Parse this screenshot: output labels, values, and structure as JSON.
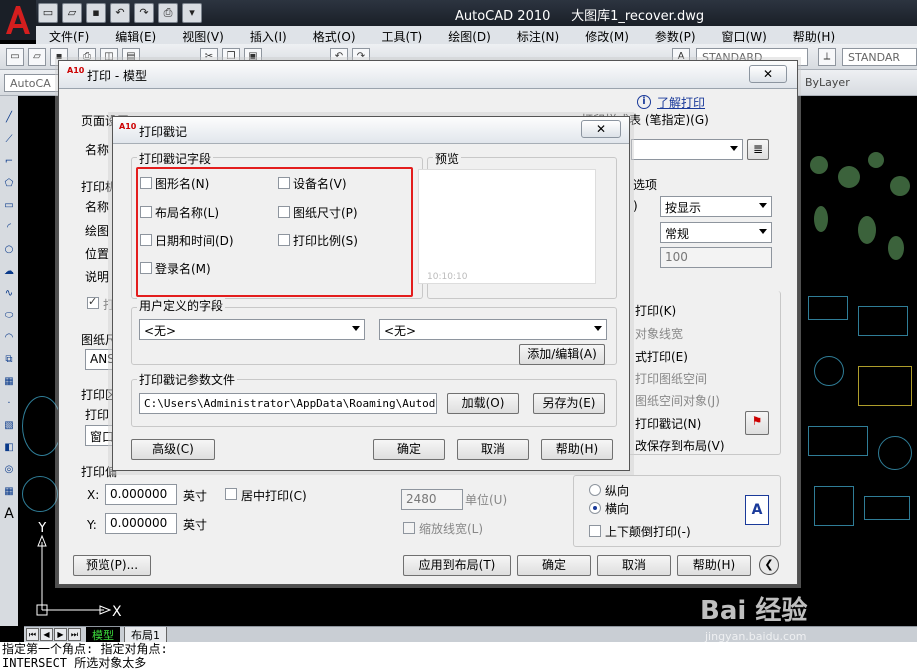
{
  "app": {
    "title": "AutoCAD 2010",
    "file": "大图库1_recover.dwg",
    "menus": [
      "文件(F)",
      "编辑(E)",
      "视图(V)",
      "插入(I)",
      "格式(O)",
      "工具(T)",
      "绘图(D)",
      "标注(N)",
      "修改(M)",
      "参数(P)",
      "窗口(W)",
      "帮助(H)"
    ],
    "toolbar_style1": "STANDARD",
    "toolbar_style2": "STANDAR",
    "workspace": "AutoCA",
    "bylayer": "ByLayer"
  },
  "tabs": {
    "model": "模型",
    "layout1": "布局1"
  },
  "command_line": {
    "line1": "指定第一个角点: 指定对角点:",
    "line2": "INTERSECT 所选对象太多"
  },
  "print_dialog": {
    "title": "打印 - 模型",
    "learn_link": "了解打印",
    "page_setup_label": "页面设置",
    "name_label": "名称",
    "printer_label_partial": "打印机",
    "printer_name_label": "名称",
    "plotter_label": "绘图",
    "where_label": "位置",
    "desc_label": "说明",
    "print_to_file_partial": "打",
    "paper_label_partial": "图纸尺",
    "paper_value_partial": "ANSI",
    "area_label_partial": "打印区",
    "area_what_partial": "打印",
    "area_window_partial": "窗口",
    "offset_label_partial": "打印偏",
    "style_table_label": "打印样式表 (笔指定)(G)",
    "options_label_partial": "选项",
    "shaded_display": "按显示",
    "quality": "常规",
    "dpi": "100",
    "options": [
      {
        "label": "打印(K)",
        "checked": true
      },
      {
        "label": "对象线宽",
        "checked": false
      },
      {
        "label": "式打印(E)",
        "checked": false
      },
      {
        "label": "打印图纸空间",
        "checked": false
      },
      {
        "label": "图纸空间对象(J)",
        "checked": false
      },
      {
        "label": "打印戳记(N)",
        "checked": true
      },
      {
        "label": "改保存到布局(V)",
        "checked": false
      }
    ],
    "x_label": "X:",
    "x_value": "0.000000",
    "x_unit": "英寸",
    "y_label": "Y:",
    "y_value": "0.000000",
    "y_unit": "英寸",
    "center_plot": "居中打印(C)",
    "scale_value": "2480",
    "scale_unit": "单位(U)",
    "scale_lineweights": "缩放线宽(L)",
    "orientation_portrait": "纵向",
    "orientation_landscape": "横向",
    "upside_down": "上下颠倒打印(-)",
    "preview_btn": "预览(P)...",
    "apply_btn": "应用到布局(T)",
    "ok_btn": "确定",
    "cancel_btn": "取消",
    "help_btn": "帮助(H)"
  },
  "stamp_dialog": {
    "title": "打印戳记",
    "fields_group": "打印戳记字段",
    "fields": [
      {
        "label": "图形名(N)",
        "checked": false
      },
      {
        "label": "布局名称(L)",
        "checked": false
      },
      {
        "label": "日期和时间(D)",
        "checked": false
      },
      {
        "label": "登录名(M)",
        "checked": false
      },
      {
        "label": "设备名(V)",
        "checked": false
      },
      {
        "label": "图纸尺寸(P)",
        "checked": false
      },
      {
        "label": "打印比例(S)",
        "checked": false
      }
    ],
    "preview_group": "预览",
    "preview_text": "10:10:10",
    "user_fields_group": "用户定义的字段",
    "user_field1": "<无>",
    "user_field2": "<无>",
    "add_edit_btn": "添加/编辑(A)",
    "param_file_group": "打印戳记参数文件",
    "param_file_path": "C:\\Users\\Administrator\\AppData\\Roaming\\Autodesk\\A",
    "load_btn": "加载(O)",
    "save_as_btn": "另存为(E)",
    "advanced_btn": "高级(C)",
    "ok_btn": "确定",
    "cancel_btn": "取消",
    "help_btn": "帮助(H)"
  },
  "watermark": {
    "brand": "Bai 经验",
    "url": "jingyan.baidu.com"
  }
}
